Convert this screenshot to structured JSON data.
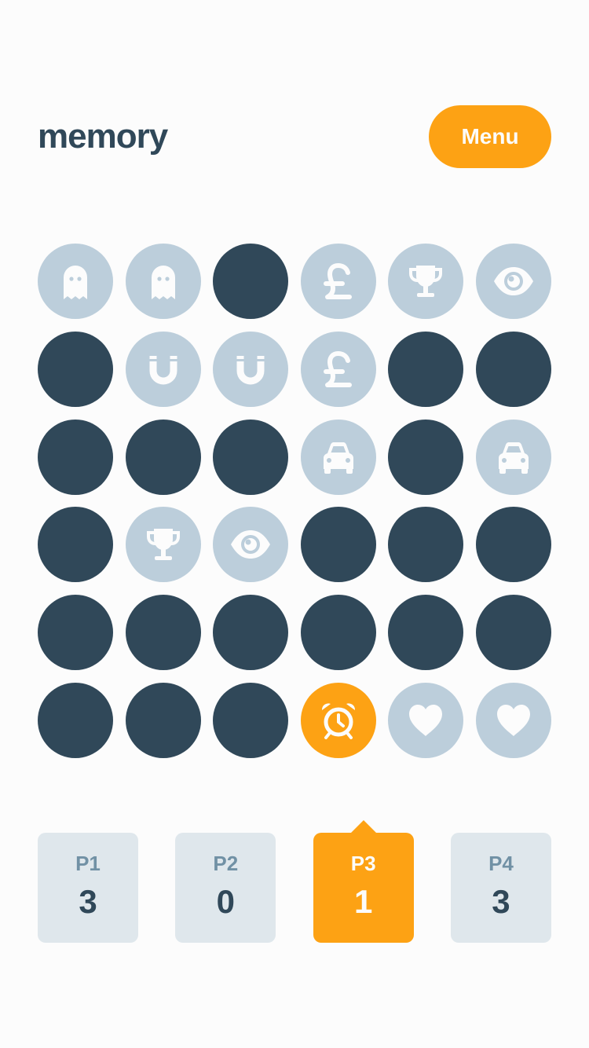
{
  "header": {
    "logo": "memory",
    "menu_label": "Menu"
  },
  "colors": {
    "background": "#fcfcfc",
    "hidden_tile": "#304859",
    "matched_tile": "#bccedb",
    "active_tile": "#fda214",
    "accent": "#fda214",
    "player_card": "#dfe7ec",
    "label_muted": "#7191a5",
    "text_dark": "#304859"
  },
  "board": {
    "columns": 6,
    "rows": 6,
    "tiles": [
      {
        "state": "matched",
        "icon": "ghost-icon"
      },
      {
        "state": "matched",
        "icon": "ghost-icon"
      },
      {
        "state": "hidden",
        "icon": null
      },
      {
        "state": "matched",
        "icon": "pound-sign-icon"
      },
      {
        "state": "matched",
        "icon": "trophy-icon"
      },
      {
        "state": "matched",
        "icon": "eye-icon"
      },
      {
        "state": "hidden",
        "icon": null
      },
      {
        "state": "matched",
        "icon": "magnet-icon"
      },
      {
        "state": "matched",
        "icon": "magnet-icon"
      },
      {
        "state": "matched",
        "icon": "pound-sign-icon"
      },
      {
        "state": "hidden",
        "icon": null
      },
      {
        "state": "hidden",
        "icon": null
      },
      {
        "state": "hidden",
        "icon": null
      },
      {
        "state": "hidden",
        "icon": null
      },
      {
        "state": "hidden",
        "icon": null
      },
      {
        "state": "matched",
        "icon": "car-icon"
      },
      {
        "state": "hidden",
        "icon": null
      },
      {
        "state": "matched",
        "icon": "car-icon"
      },
      {
        "state": "hidden",
        "icon": null
      },
      {
        "state": "matched",
        "icon": "trophy-icon"
      },
      {
        "state": "matched",
        "icon": "eye-icon"
      },
      {
        "state": "hidden",
        "icon": null
      },
      {
        "state": "hidden",
        "icon": null
      },
      {
        "state": "hidden",
        "icon": null
      },
      {
        "state": "hidden",
        "icon": null
      },
      {
        "state": "hidden",
        "icon": null
      },
      {
        "state": "hidden",
        "icon": null
      },
      {
        "state": "hidden",
        "icon": null
      },
      {
        "state": "hidden",
        "icon": null
      },
      {
        "state": "hidden",
        "icon": null
      },
      {
        "state": "hidden",
        "icon": null
      },
      {
        "state": "hidden",
        "icon": null
      },
      {
        "state": "hidden",
        "icon": null
      },
      {
        "state": "active",
        "icon": "alarm-clock-icon"
      },
      {
        "state": "matched",
        "icon": "heart-icon"
      },
      {
        "state": "matched",
        "icon": "heart-icon"
      }
    ]
  },
  "players": [
    {
      "name": "P1",
      "score": "3",
      "current": false
    },
    {
      "name": "P2",
      "score": "0",
      "current": false
    },
    {
      "name": "P3",
      "score": "1",
      "current": true
    },
    {
      "name": "P4",
      "score": "3",
      "current": false
    }
  ]
}
